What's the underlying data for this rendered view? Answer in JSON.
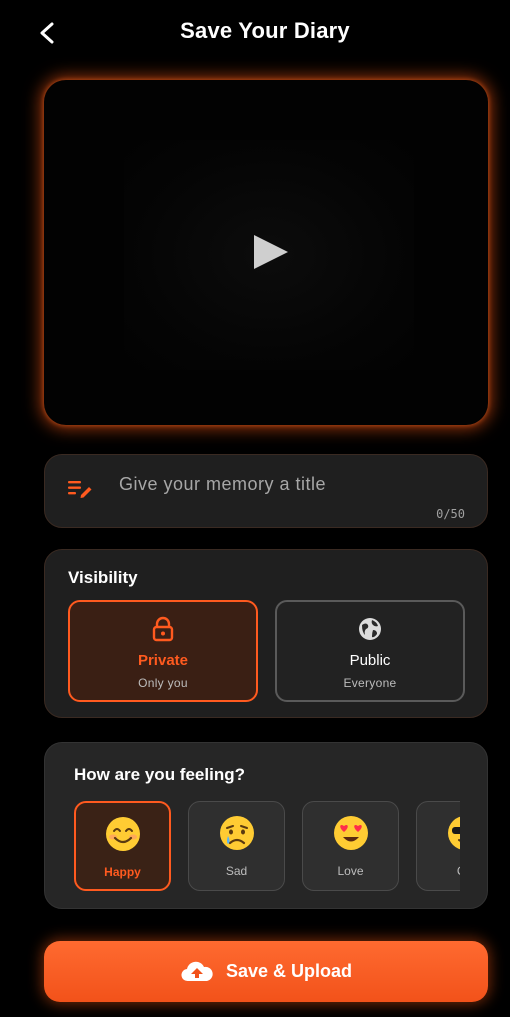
{
  "header": {
    "title": "Save Your Diary",
    "back_icon": "chevron-left-icon"
  },
  "video": {
    "play_icon": "play-icon"
  },
  "title_input": {
    "placeholder": "Give your memory a title",
    "value": "",
    "char_count": "0/50",
    "icon": "edit-title-icon"
  },
  "visibility": {
    "heading": "Visibility",
    "options": [
      {
        "label": "Private",
        "sublabel": "Only you",
        "icon": "lock-icon",
        "selected": true
      },
      {
        "label": "Public",
        "sublabel": "Everyone",
        "icon": "globe-icon",
        "selected": false
      }
    ]
  },
  "mood": {
    "heading": "How are you feeling?",
    "options": [
      {
        "label": "Happy",
        "emoji": "😊",
        "selected": true
      },
      {
        "label": "Sad",
        "emoji": "😢",
        "selected": false
      },
      {
        "label": "Love",
        "emoji": "😍",
        "selected": false
      },
      {
        "label": "Co",
        "emoji": "😎",
        "selected": false
      }
    ]
  },
  "save_button": {
    "label": "Save & Upload",
    "icon": "cloud-upload-icon"
  },
  "colors": {
    "accent": "#ff5a1f",
    "background": "#000000",
    "card": "#1f1f1f"
  }
}
